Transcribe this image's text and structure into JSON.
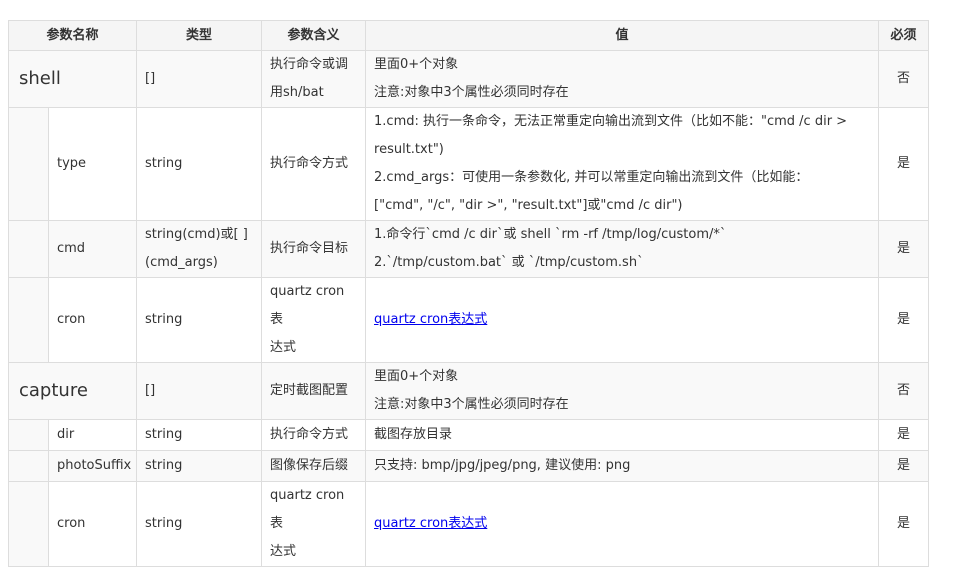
{
  "headers": {
    "name": "参数名称",
    "type": "类型",
    "meaning": "参数含义",
    "value": "值",
    "required": "必须"
  },
  "rows": {
    "shell": {
      "name": "shell",
      "type": "[]",
      "meaning": [
        "执行命令或调",
        "用sh/bat"
      ],
      "value": [
        "里面0+个对象",
        "注意:对象中3个属性必须同时存在"
      ],
      "required": "否"
    },
    "shell_type": {
      "name": "type",
      "type": "string",
      "meaning": "执行命令方式",
      "value": [
        "1.cmd: 执行一条命令，无法正常重定向输出流到文件（比如不能：\"cmd /c dir >",
        "result.txt\")",
        "2.cmd_args：可使用一条参数化, 并可以常重定向输出流到文件（比如能：",
        "[\"cmd\", \"/c\", \"dir >\", \"result.txt\"]或\"cmd /c dir\")"
      ],
      "required": "是"
    },
    "shell_cmd": {
      "name": "cmd",
      "type": [
        "string(cmd)或[ ]",
        "(cmd_args)"
      ],
      "meaning": "执行命令目标",
      "value": [
        "1.命令行`cmd /c dir`或 shell `rm -rf /tmp/log/custom/*`",
        "2.`/tmp/custom.bat` 或 `/tmp/custom.sh`"
      ],
      "required": "是"
    },
    "shell_cron": {
      "name": "cron",
      "type": "string",
      "meaning": [
        "quartz cron表",
        "达式"
      ],
      "value": "quartz cron表达式",
      "required": "是"
    },
    "capture": {
      "name": "capture",
      "type": "[]",
      "meaning": "定时截图配置",
      "value": [
        "里面0+个对象",
        "注意:对象中3个属性必须同时存在"
      ],
      "required": "否"
    },
    "capture_dir": {
      "name": "dir",
      "type": "string",
      "meaning": "执行命令方式",
      "value": "截图存放目录",
      "required": "是"
    },
    "capture_photoSuffix": {
      "name": "photoSuffix",
      "type": "string",
      "meaning": "图像保存后缀",
      "value": "只支持: bmp/jpg/jpeg/png, 建议使用: png",
      "required": "是"
    },
    "capture_cron": {
      "name": "cron",
      "type": "string",
      "meaning": [
        "quartz cron表",
        "达式"
      ],
      "value": "quartz cron表达式",
      "required": "是"
    }
  }
}
